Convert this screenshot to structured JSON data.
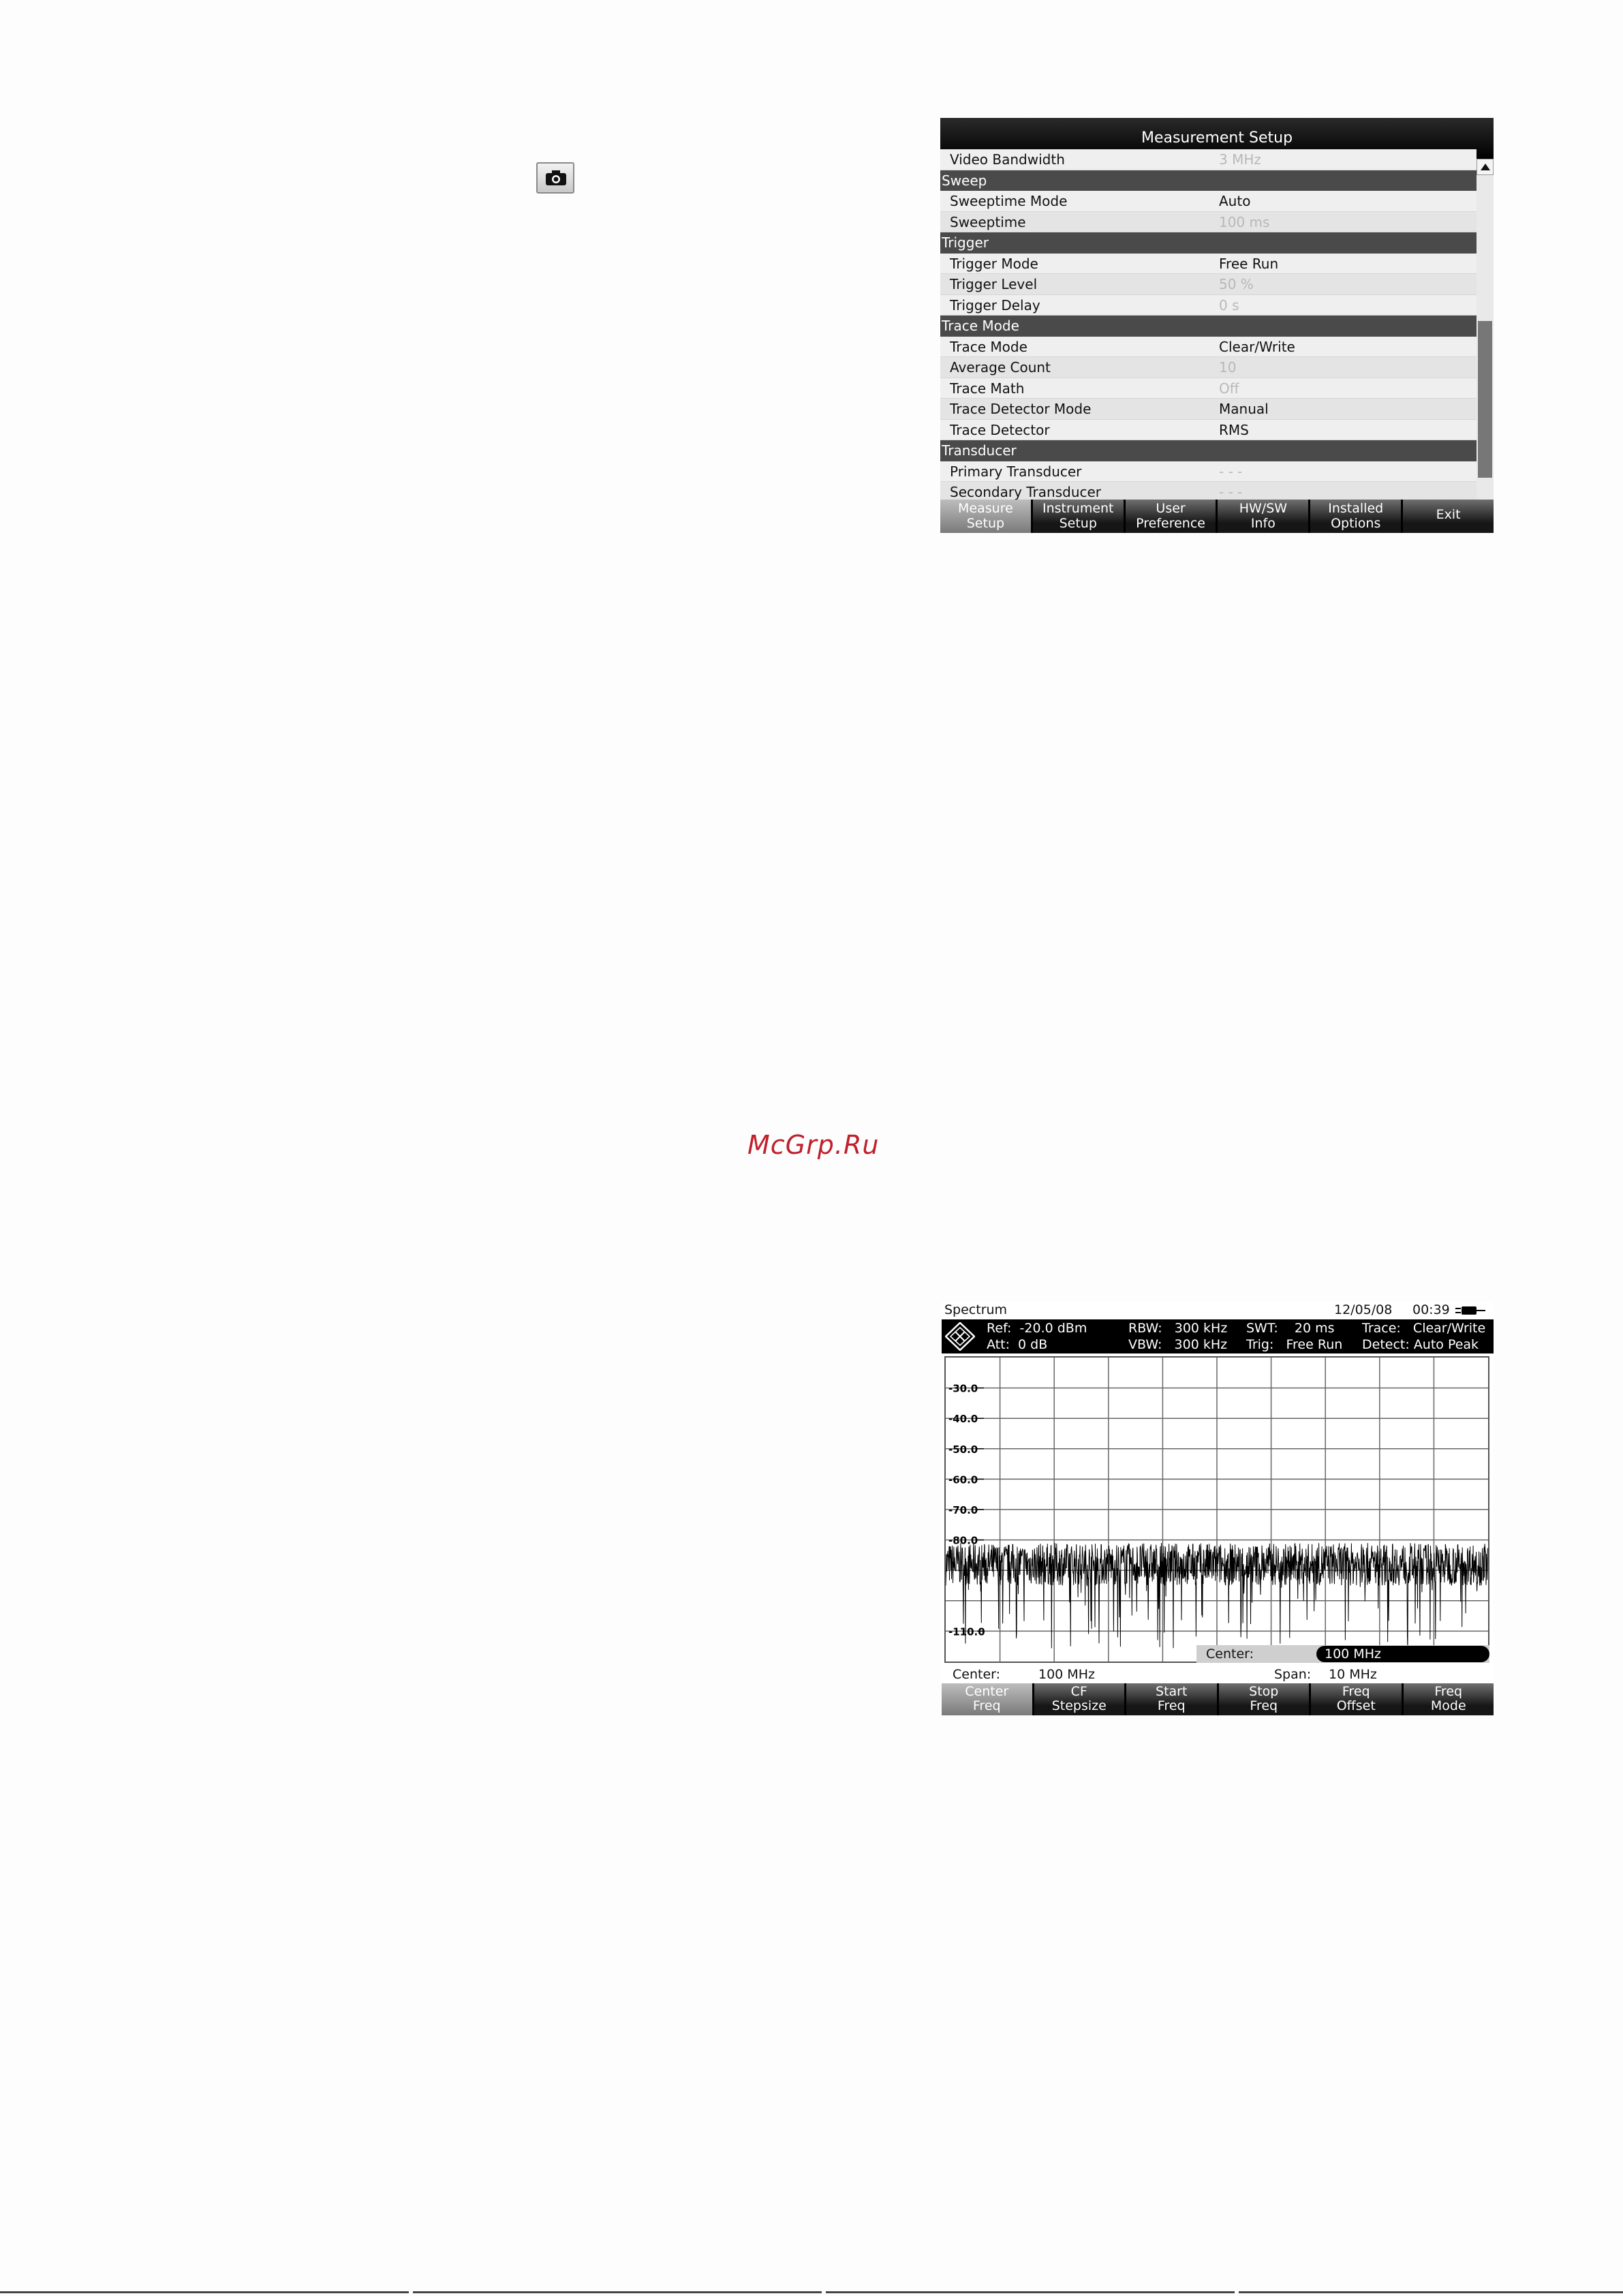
{
  "page": {
    "camera_icon": "camera-icon",
    "watermark": "McGrp.Ru"
  },
  "setup_screen": {
    "title": "Measurement Setup",
    "cut_row": {
      "label": "Video Bandwidth",
      "value": "3 MHz"
    },
    "sections": [
      {
        "header": "Sweep",
        "items": [
          {
            "label": "Sweeptime Mode",
            "value": "Auto",
            "dim": false
          },
          {
            "label": "Sweeptime",
            "value": "100 ms",
            "dim": true
          }
        ]
      },
      {
        "header": "Trigger",
        "items": [
          {
            "label": "Trigger Mode",
            "value": "Free Run",
            "dim": false
          },
          {
            "label": "Trigger Level",
            "value": "50 %",
            "dim": true
          },
          {
            "label": "Trigger Delay",
            "value": "0 s",
            "dim": true
          }
        ]
      },
      {
        "header": "Trace Mode",
        "items": [
          {
            "label": "Trace Mode",
            "value": "Clear/Write",
            "dim": false
          },
          {
            "label": "Average Count",
            "value": "10",
            "dim": true
          },
          {
            "label": "Trace Math",
            "value": "Off",
            "dim": true
          },
          {
            "label": "Trace Detector Mode",
            "value": "Manual",
            "dim": false
          },
          {
            "label": "Trace Detector",
            "value": "RMS",
            "dim": false
          }
        ]
      },
      {
        "header": "Transducer",
        "items": [
          {
            "label": "Primary Transducer",
            "value": "- - -",
            "dim": true
          },
          {
            "label": "Secondary Transducer",
            "value": "- - -",
            "dim": true
          }
        ]
      }
    ],
    "softkeys": [
      {
        "line1": "Measure",
        "line2": "Setup",
        "active": true
      },
      {
        "line1": "Instrument",
        "line2": "Setup",
        "active": false
      },
      {
        "line1": "User",
        "line2": "Preference",
        "active": false
      },
      {
        "line1": "HW/SW",
        "line2": "Info",
        "active": false
      },
      {
        "line1": "Installed",
        "line2": "Options",
        "active": false
      },
      {
        "line1": "Exit",
        "line2": "",
        "active": false
      }
    ]
  },
  "spectrum_screen": {
    "mode": "Spectrum",
    "date": "12/05/08",
    "time": "00:39",
    "info": {
      "ref": "Ref:  -20.0 dBm",
      "att": "Att:  0 dB",
      "rbw": "RBW:   300 kHz",
      "vbw": "VBW:   300 kHz",
      "swt": "SWT:    20 ms",
      "trig": "Trig:   Free Run",
      "trace": "Trace:   Clear/Write",
      "detect": "Detect: Auto Peak"
    },
    "center_input": {
      "label": "Center:",
      "value": "100 MHz"
    },
    "status": {
      "center_label": "Center:",
      "center_value": "100 MHz",
      "span_label": "Span:",
      "span_value": "10 MHz"
    },
    "softkeys": [
      {
        "line1": "Center",
        "line2": "Freq",
        "active": true
      },
      {
        "line1": "CF",
        "line2": "Stepsize",
        "active": false
      },
      {
        "line1": "Start",
        "line2": "Freq",
        "active": false
      },
      {
        "line1": "Stop",
        "line2": "Freq",
        "active": false
      },
      {
        "line1": "Freq",
        "line2": "Offset",
        "active": false
      },
      {
        "line1": "Freq",
        "line2": "Mode",
        "active": false
      }
    ],
    "chart_data": {
      "type": "line",
      "y_tick_labels": [
        "-30.0",
        "-40.0",
        "-50.0",
        "-60.0",
        "-70.0",
        "-80.0",
        "-110.0"
      ],
      "y_ticks": [
        -30,
        -40,
        -50,
        -60,
        -70,
        -80,
        -110
      ],
      "ylim": [
        -20,
        -120
      ],
      "grid": true,
      "series": [
        {
          "noise_floor_dbm": -88,
          "peak_dbm": -80,
          "min_dbm": -110
        }
      ]
    }
  }
}
